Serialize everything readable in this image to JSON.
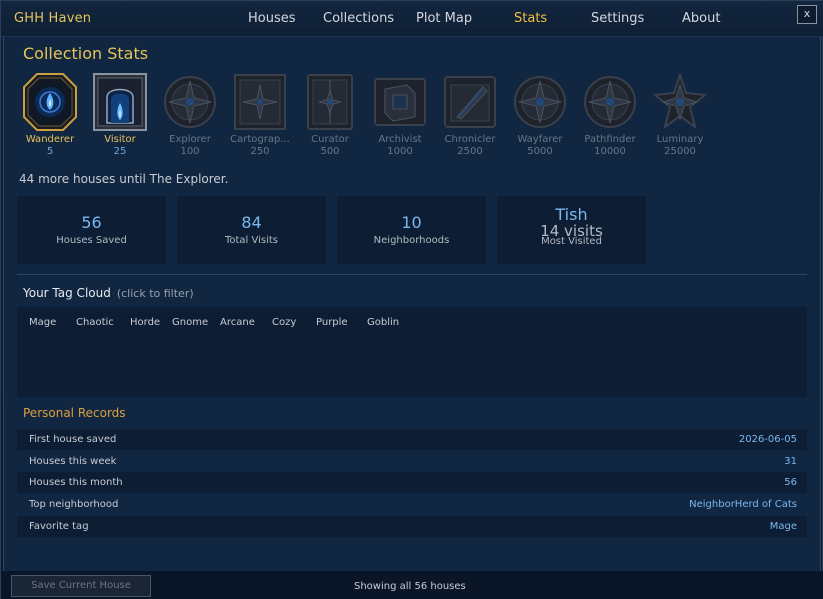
{
  "app_title": "GHH Haven",
  "nav": [
    {
      "label": "Houses",
      "active": false
    },
    {
      "label": "Collections",
      "active": false
    },
    {
      "label": "Plot Map",
      "active": false
    },
    {
      "label": "Stats",
      "active": true
    },
    {
      "label": "Settings",
      "active": false
    },
    {
      "label": "About",
      "active": false
    }
  ],
  "close_label": "x",
  "section_title": "Collection Stats",
  "badges": [
    {
      "name": "Wanderer",
      "req": "5",
      "unlocked": true,
      "icon": "flame-emblem-icon"
    },
    {
      "name": "Visitor",
      "req": "25",
      "unlocked": true,
      "icon": "portal-emblem-icon"
    },
    {
      "name": "Explorer",
      "req": "100",
      "unlocked": false,
      "icon": "compass-icon"
    },
    {
      "name": "Cartograp...",
      "req": "250",
      "unlocked": false,
      "icon": "map-icon"
    },
    {
      "name": "Curator",
      "req": "500",
      "unlocked": false,
      "icon": "book-icon"
    },
    {
      "name": "Archivist",
      "req": "1000",
      "unlocked": false,
      "icon": "tome-icon"
    },
    {
      "name": "Chronicler",
      "req": "2500",
      "unlocked": false,
      "icon": "quill-icon"
    },
    {
      "name": "Wayfarer",
      "req": "5000",
      "unlocked": false,
      "icon": "compass-icon"
    },
    {
      "name": "Pathfinder",
      "req": "10000",
      "unlocked": false,
      "icon": "compass-icon"
    },
    {
      "name": "Luminary",
      "req": "25000",
      "unlocked": false,
      "icon": "star-icon"
    }
  ],
  "progress_text": "44 more houses until The Explorer.",
  "stats": {
    "houses_saved": {
      "value": "56",
      "label": "Houses Saved"
    },
    "total_visits": {
      "value": "84",
      "label": "Total Visits"
    },
    "neighborhoods": {
      "value": "10",
      "label": "Neighborhoods"
    },
    "most_visited": {
      "value": "Tish",
      "sub": "14 visits",
      "label": "Most Visited"
    }
  },
  "tag_cloud": {
    "title": "Your Tag Cloud",
    "hint": "(click to filter)",
    "tags": [
      "Mage",
      "Chaotic",
      "Horde",
      "Gnome",
      "Arcane",
      "Cozy",
      "Purple",
      "Goblin"
    ]
  },
  "records": {
    "title": "Personal Records",
    "rows": [
      {
        "key": "First house saved",
        "value": "2026-06-05"
      },
      {
        "key": "Houses this week",
        "value": "31"
      },
      {
        "key": "Houses this month",
        "value": "56"
      },
      {
        "key": "Top neighborhood",
        "value": "NeighborHerd of Cats"
      },
      {
        "key": "Favorite tag",
        "value": "Mage"
      }
    ]
  },
  "footer": {
    "save_label": "Save Current House",
    "status": "Showing all 56 houses"
  },
  "colors": {
    "gold": "#e6c45a",
    "accent_blue": "#7ab8f0",
    "background": "#112640"
  }
}
